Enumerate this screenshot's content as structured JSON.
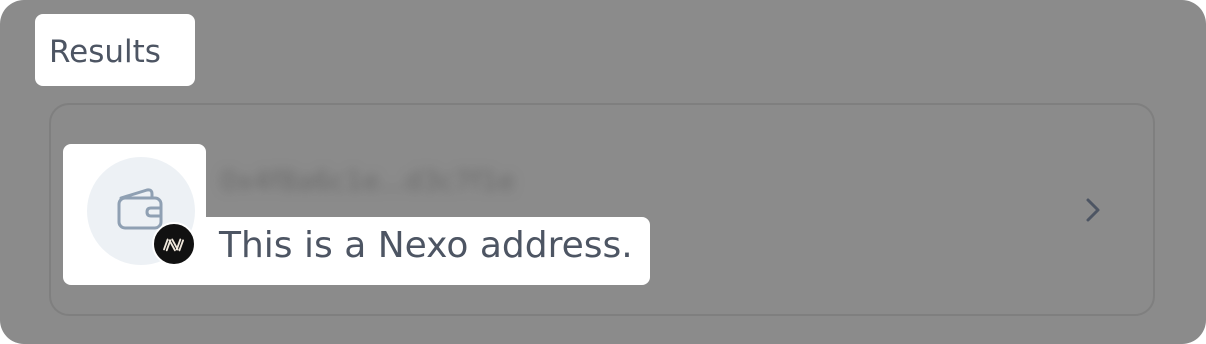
{
  "results": {
    "title": "Results"
  },
  "result_item": {
    "name_blurred": "0x4f8a6c1e...d3c7f1e",
    "description": "This is a Nexo address.",
    "avatar_icon": "wallet-icon",
    "badge_icon": "nexo-logo-icon",
    "chevron_icon": "chevron-right-icon"
  },
  "colors": {
    "overlay": "#8b8b8b",
    "text_primary": "#4d5563",
    "avatar_bg": "#edf1f5",
    "wallet_stroke": "#8fa0b3",
    "badge_bg": "#111111"
  }
}
